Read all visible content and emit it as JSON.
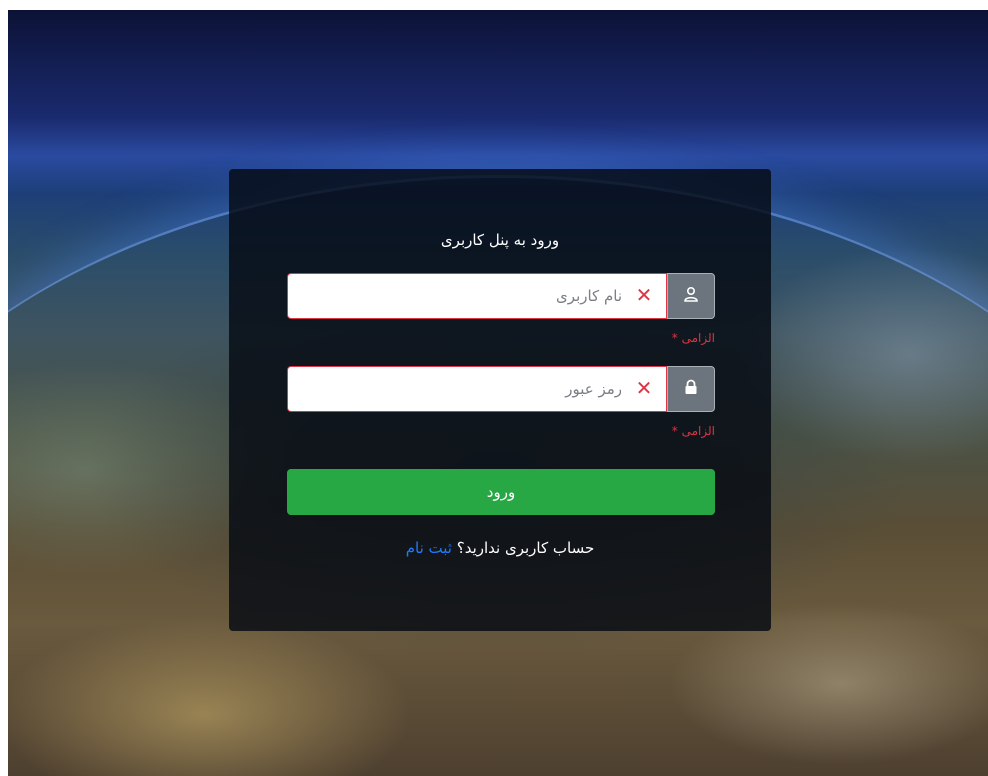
{
  "login": {
    "title": "ورود به پنل کاربری",
    "username": {
      "placeholder": "نام کاربری",
      "value": "",
      "icon": "user-icon",
      "status_icon": "x-mark-icon",
      "error": "الزامی *"
    },
    "password": {
      "placeholder": "رمز عبور",
      "value": "",
      "icon": "lock-icon",
      "status_icon": "x-mark-icon",
      "error": "الزامی *"
    },
    "submit_label": "ورود",
    "signup_prompt": "حساب کاربری ندارید؟",
    "signup_link": "ثبت نام"
  },
  "colors": {
    "error": "#dc3545",
    "submit": "#28a745",
    "link": "#1e7bff",
    "addon": "#6c757d"
  }
}
